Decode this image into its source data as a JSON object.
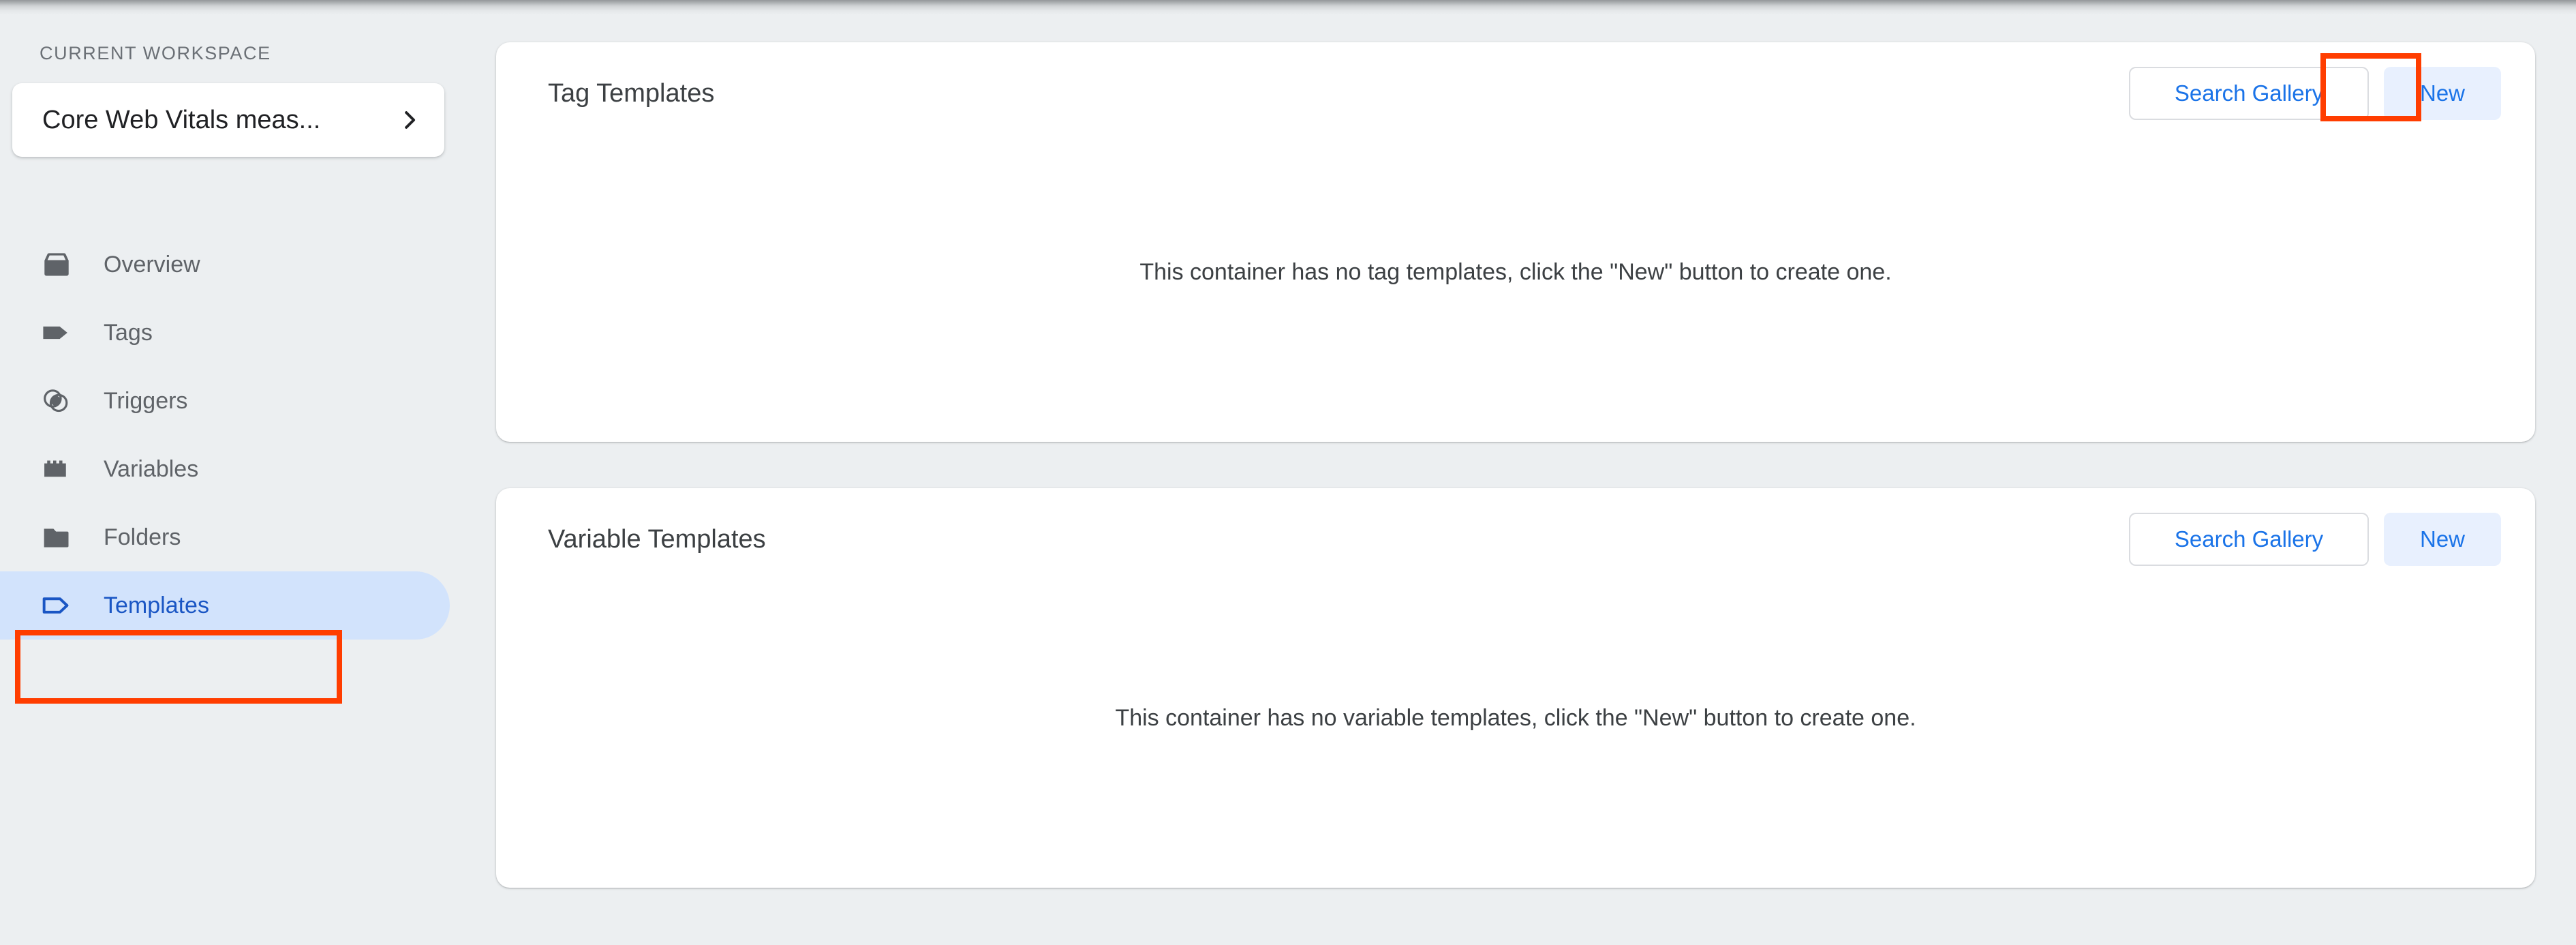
{
  "sidebar": {
    "workspace_section_label": "CURRENT WORKSPACE",
    "workspace_name": "Core Web Vitals meas...",
    "workspace_chevron_icon": "chevron-right-icon",
    "items": [
      {
        "label": "Overview",
        "icon": "overview-box-icon",
        "active": false
      },
      {
        "label": "Tags",
        "icon": "tag-filled-icon",
        "active": false
      },
      {
        "label": "Triggers",
        "icon": "triggers-circles-icon",
        "active": false
      },
      {
        "label": "Variables",
        "icon": "variables-block-icon",
        "active": false
      },
      {
        "label": "Folders",
        "icon": "folder-icon",
        "active": false
      },
      {
        "label": "Templates",
        "icon": "template-tag-outline-icon",
        "active": true
      }
    ]
  },
  "main": {
    "cards": [
      {
        "title": "Tag Templates",
        "search_gallery_label": "Search Gallery",
        "new_label": "New",
        "empty_message": "This container has no tag templates, click the \"New\" button to create one."
      },
      {
        "title": "Variable Templates",
        "search_gallery_label": "Search Gallery",
        "new_label": "New",
        "empty_message": "This container has no variable templates, click the \"New\" button to create one."
      }
    ]
  },
  "annotations": {
    "highlight_color": "#ff3d00",
    "boxes": [
      {
        "target": "sidebar-item-templates"
      },
      {
        "target": "tag-templates-new-button"
      }
    ]
  },
  "colors": {
    "page_background": "#eceff1",
    "card_background": "#ffffff",
    "accent_blue": "#1a73e8",
    "active_nav_background": "#d2e3fc",
    "active_nav_text": "#1a56c4",
    "tonal_button_background": "#e8f0fe",
    "muted_text": "#5f6368",
    "body_text": "#3c4043"
  }
}
